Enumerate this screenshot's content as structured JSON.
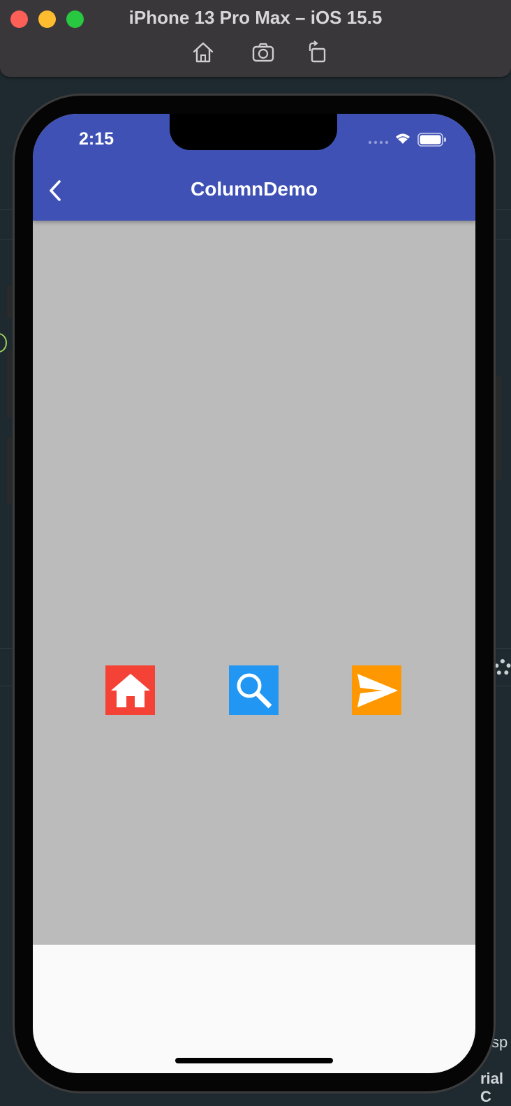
{
  "simulator": {
    "title": "iPhone 13 Pro Max – iOS 15.5",
    "toolbar": [
      "home-icon",
      "screenshot-icon",
      "rotate-icon"
    ]
  },
  "status_bar": {
    "time": "2:15"
  },
  "app_bar": {
    "title": "ColumnDemo",
    "color": "#3f51b5"
  },
  "body": {
    "background": "#bbbbbb",
    "icons": [
      {
        "name": "home-icon",
        "color": "#f44336"
      },
      {
        "name": "search-icon",
        "color": "#2196f3"
      },
      {
        "name": "send-icon",
        "color": "#ff9800"
      }
    ]
  },
  "background_ide": {
    "edge_text_1": "sp",
    "edge_text_2": "rial C"
  }
}
